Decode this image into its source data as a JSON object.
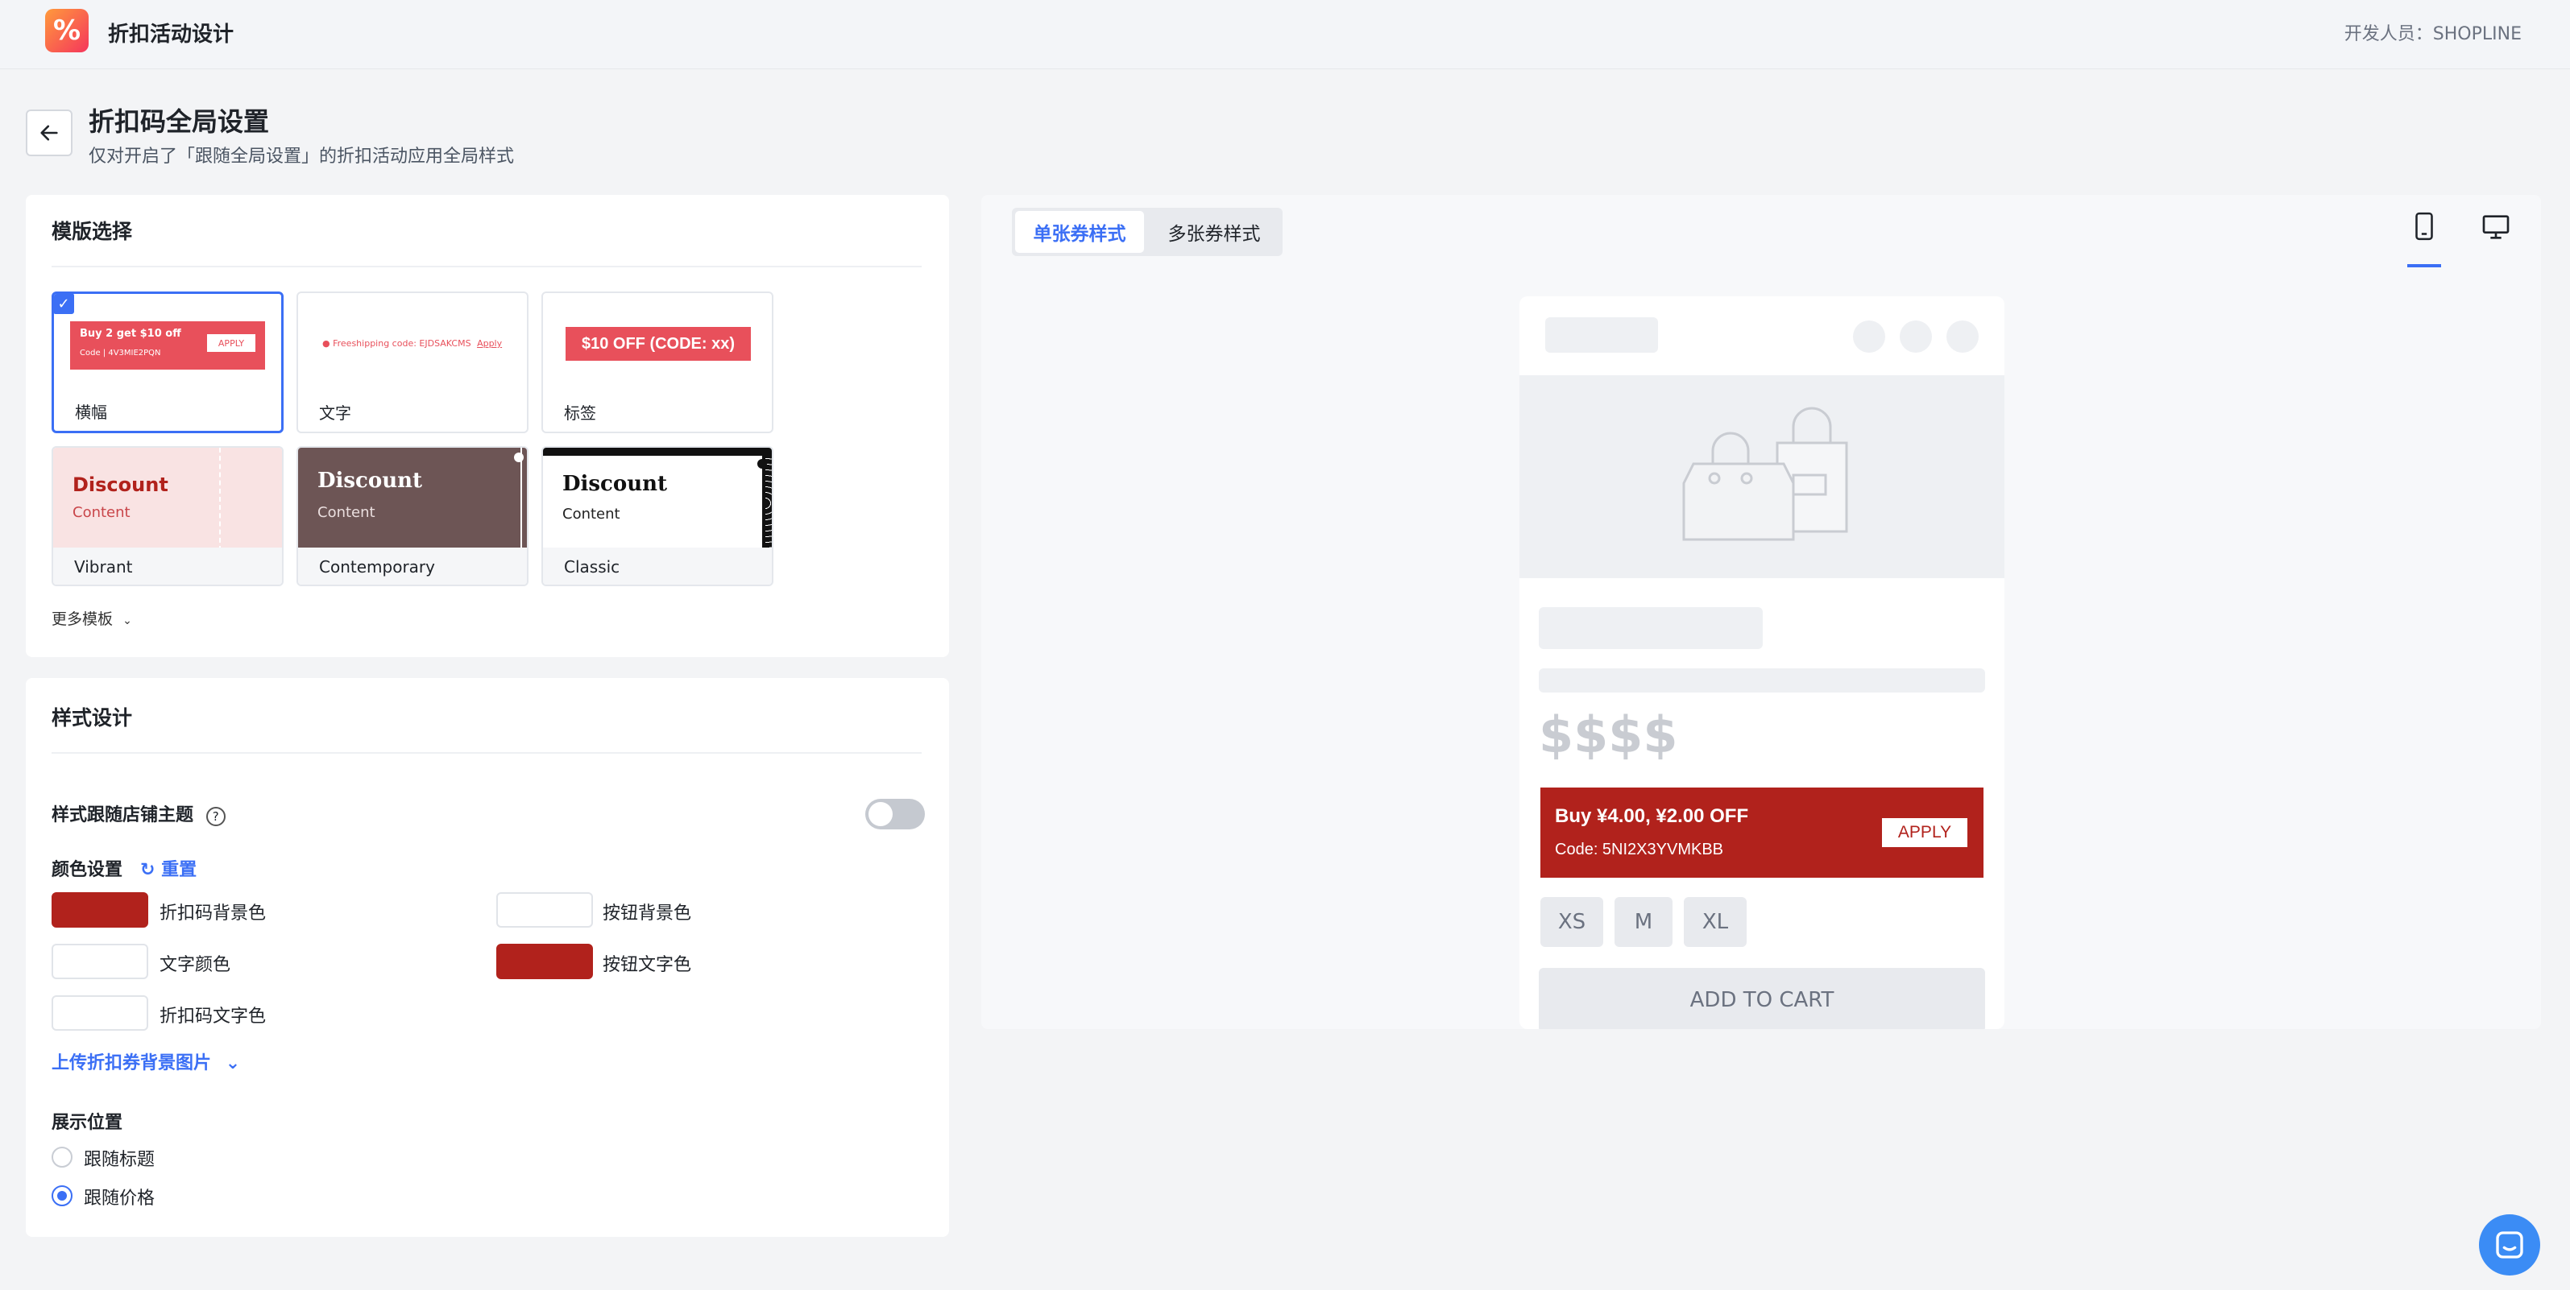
{
  "app": {
    "logo_glyph": "%",
    "title": "折扣活动设计",
    "developer": "开发人员：SHOPLINE"
  },
  "page": {
    "title": "折扣码全局设置",
    "subtitle": "仅对开启了「跟随全局设置」的折扣活动应用全局样式"
  },
  "template_section": {
    "title": "模版选择",
    "more": "更多模板",
    "templates": [
      {
        "label": "横幅",
        "selected": true,
        "preview_line1": "Buy 2 get $10 off",
        "preview_line2": "Code | 4V3MIE2PQN",
        "preview_btn": "APPLY"
      },
      {
        "label": "文字",
        "selected": false,
        "preview_text": "Freeshipping code: EJDSAKCMS",
        "preview_link": "Apply"
      },
      {
        "label": "标签",
        "selected": false,
        "preview_text": "$10 OFF (CODE: xx)"
      },
      {
        "label": "Vibrant",
        "selected": false,
        "preview_title": "Discount",
        "preview_sub": "Content"
      },
      {
        "label": "Contemporary",
        "selected": false,
        "preview_title": "Discount",
        "preview_sub": "Content"
      },
      {
        "label": "Classic",
        "selected": false,
        "preview_title": "Discount",
        "preview_sub": "Content"
      }
    ]
  },
  "style_section": {
    "title": "样式设计",
    "follow_theme_label": "样式跟随店铺主题",
    "follow_theme_on": false,
    "color_title": "颜色设置",
    "reset_label": "重置",
    "colors": {
      "code_bg": {
        "label": "折扣码背景色",
        "value": "#b1221c"
      },
      "btn_bg": {
        "label": "按钮背景色",
        "value": "#ffffff"
      },
      "text_color": {
        "label": "文字颜色",
        "value": "#ffffff"
      },
      "btn_text": {
        "label": "按钮文字色",
        "value": "#b1221c"
      },
      "code_text": {
        "label": "折扣码文字色",
        "value": "#ffffff"
      }
    },
    "upload_label": "上传折扣券背景图片",
    "position_title": "展示位置",
    "positions": [
      {
        "label": "跟随标题",
        "checked": false
      },
      {
        "label": "跟随价格",
        "checked": true
      }
    ]
  },
  "preview": {
    "tabs": [
      "单张券样式",
      "多张券样式"
    ],
    "active_tab": 0,
    "price": "$$$$",
    "coupon_title": "Buy ¥4.00, ¥2.00 OFF",
    "coupon_code": "Code: 5NI2X3YVMKBB",
    "coupon_btn": "APPLY",
    "sizes": [
      "XS",
      "M",
      "XL"
    ],
    "add_to_cart": "ADD TO CART"
  },
  "colors": {
    "accent": "#3b6ff5",
    "coupon_red": "#b1221c",
    "tag_red": "#e8505b"
  }
}
